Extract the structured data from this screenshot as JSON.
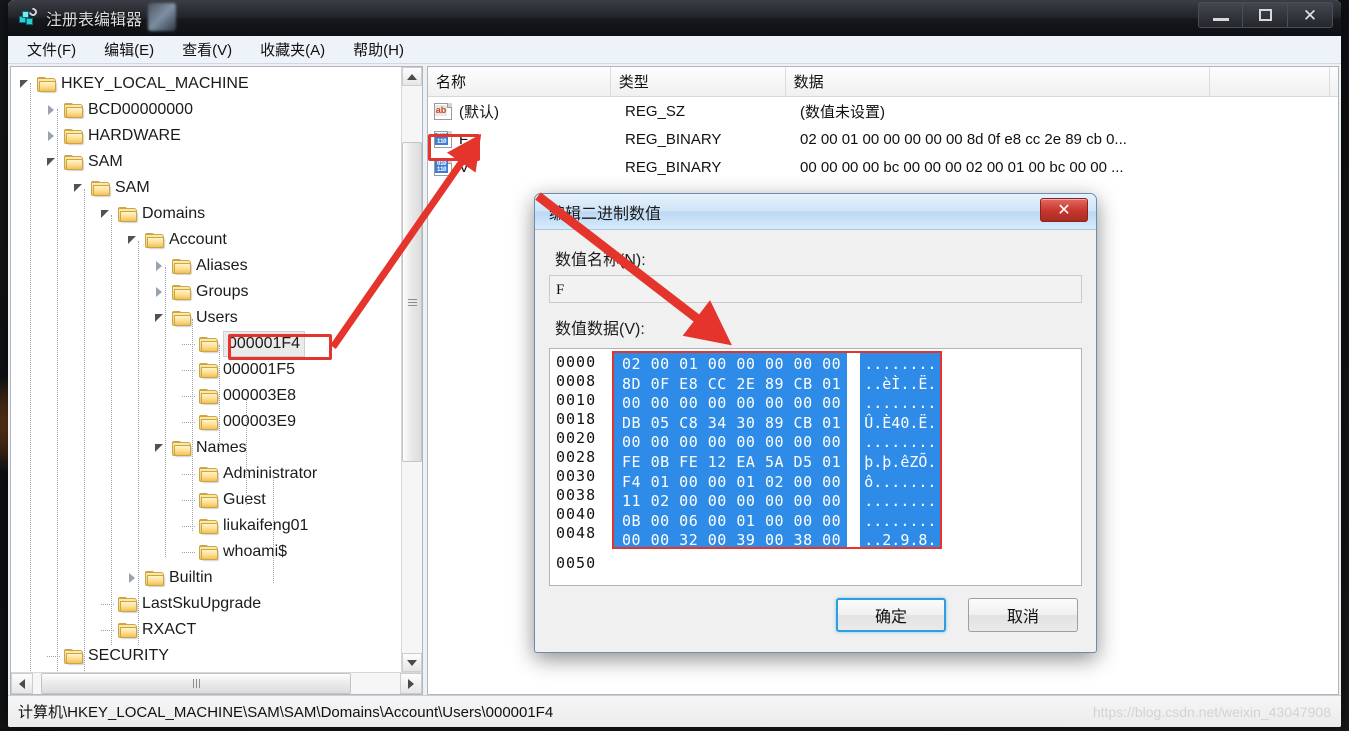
{
  "window": {
    "title": "注册表编辑器",
    "icon": "registry-icon",
    "controls": {
      "minimize": "–",
      "maximize": "❐",
      "close": "✕"
    }
  },
  "menubar": {
    "items": [
      {
        "label": "文件(F)",
        "name": "menu-file"
      },
      {
        "label": "编辑(E)",
        "name": "menu-edit"
      },
      {
        "label": "查看(V)",
        "name": "menu-view"
      },
      {
        "label": "收藏夹(A)",
        "name": "menu-favorites"
      },
      {
        "label": "帮助(H)",
        "name": "menu-help"
      }
    ]
  },
  "tree": {
    "nodes": [
      {
        "label": "HKEY_LOCAL_MACHINE",
        "depth": 0,
        "state": "expanded"
      },
      {
        "label": "BCD00000000",
        "depth": 1,
        "state": "collapsed"
      },
      {
        "label": "HARDWARE",
        "depth": 1,
        "state": "collapsed"
      },
      {
        "label": "SAM",
        "depth": 1,
        "state": "expanded"
      },
      {
        "label": "SAM",
        "depth": 2,
        "state": "expanded"
      },
      {
        "label": "Domains",
        "depth": 3,
        "state": "expanded"
      },
      {
        "label": "Account",
        "depth": 4,
        "state": "expanded"
      },
      {
        "label": "Aliases",
        "depth": 5,
        "state": "collapsed"
      },
      {
        "label": "Groups",
        "depth": 5,
        "state": "collapsed"
      },
      {
        "label": "Users",
        "depth": 5,
        "state": "expanded"
      },
      {
        "label": "000001F4",
        "depth": 6,
        "state": "leaf",
        "selected": true,
        "highlighted": true
      },
      {
        "label": "000001F5",
        "depth": 6,
        "state": "leaf"
      },
      {
        "label": "000003E8",
        "depth": 6,
        "state": "leaf"
      },
      {
        "label": "000003E9",
        "depth": 6,
        "state": "leaf"
      },
      {
        "label": "Names",
        "depth": 5,
        "state": "expanded"
      },
      {
        "label": "Administrator",
        "depth": 6,
        "state": "leaf"
      },
      {
        "label": "Guest",
        "depth": 6,
        "state": "leaf"
      },
      {
        "label": "liukaifeng01",
        "depth": 6,
        "state": "leaf"
      },
      {
        "label": "whoami$",
        "depth": 6,
        "state": "leaf"
      },
      {
        "label": "Builtin",
        "depth": 4,
        "state": "collapsed"
      },
      {
        "label": "LastSkuUpgrade",
        "depth": 3,
        "state": "leaf"
      },
      {
        "label": "RXACT",
        "depth": 3,
        "state": "leaf"
      },
      {
        "label": "SECURITY",
        "depth": 1,
        "state": "leaf"
      }
    ]
  },
  "list": {
    "columns": [
      {
        "label": "名称",
        "name": "column-name"
      },
      {
        "label": "类型",
        "name": "column-type"
      },
      {
        "label": "数据",
        "name": "column-data"
      }
    ],
    "rows": [
      {
        "icon": "string-value-icon",
        "name": "(默认)",
        "type": "REG_SZ",
        "data": "(数值未设置)"
      },
      {
        "icon": "binary-value-icon",
        "name": "F",
        "type": "REG_BINARY",
        "data": "02 00 01 00 00 00 00 00 8d 0f e8 cc 2e 89 cb 0...",
        "highlighted": true
      },
      {
        "icon": "binary-value-icon",
        "name": "V",
        "type": "REG_BINARY",
        "data": "00 00 00 00 bc 00 00 00 02 00 01 00 bc 00 00 ..."
      }
    ]
  },
  "statusbar": {
    "path": "计算机\\HKEY_LOCAL_MACHINE\\SAM\\SAM\\Domains\\Account\\Users\\000001F4",
    "watermark": "https://blog.csdn.net/weixin_43047908"
  },
  "dialog": {
    "title": "编辑二进制数值",
    "close_label": "✕",
    "value_name_label": "数值名称(N):",
    "value_name": "F",
    "value_data_label": "数值数据(V):",
    "ok_label": "确定",
    "cancel_label": "取消",
    "hex": {
      "offsets": [
        "0000",
        "0008",
        "0010",
        "0018",
        "0020",
        "0028",
        "0030",
        "0038",
        "0040",
        "0048"
      ],
      "tail_offset": "0050",
      "bytes": [
        "02 00 01 00 00 00 00 00",
        "8D 0F E8 CC 2E 89 CB 01",
        "00 00 00 00 00 00 00 00",
        "DB 05 C8 34 30 89 CB 01",
        "00 00 00 00 00 00 00 00",
        "FE 0B FE 12 EA 5A D5 01",
        "F4 01 00 00 01 02 00 00",
        "11 02 00 00 00 00 00 00",
        "0B 00 06 00 01 00 00 00",
        "00 00 32 00 39 00 38 00"
      ],
      "ascii": [
        "........",
        "..èÌ..Ë.",
        "........",
        "Û.È40.Ë.",
        "........",
        "þ.þ.êZÕ.",
        "ô.......",
        "........",
        "........",
        "..2.9.8."
      ]
    }
  },
  "colors": {
    "selection_blue": "#2e8ce8",
    "annotation_red": "#e4342b",
    "titlebar_dark": "#22262b",
    "dialog_blue": "#cfe4f7"
  }
}
